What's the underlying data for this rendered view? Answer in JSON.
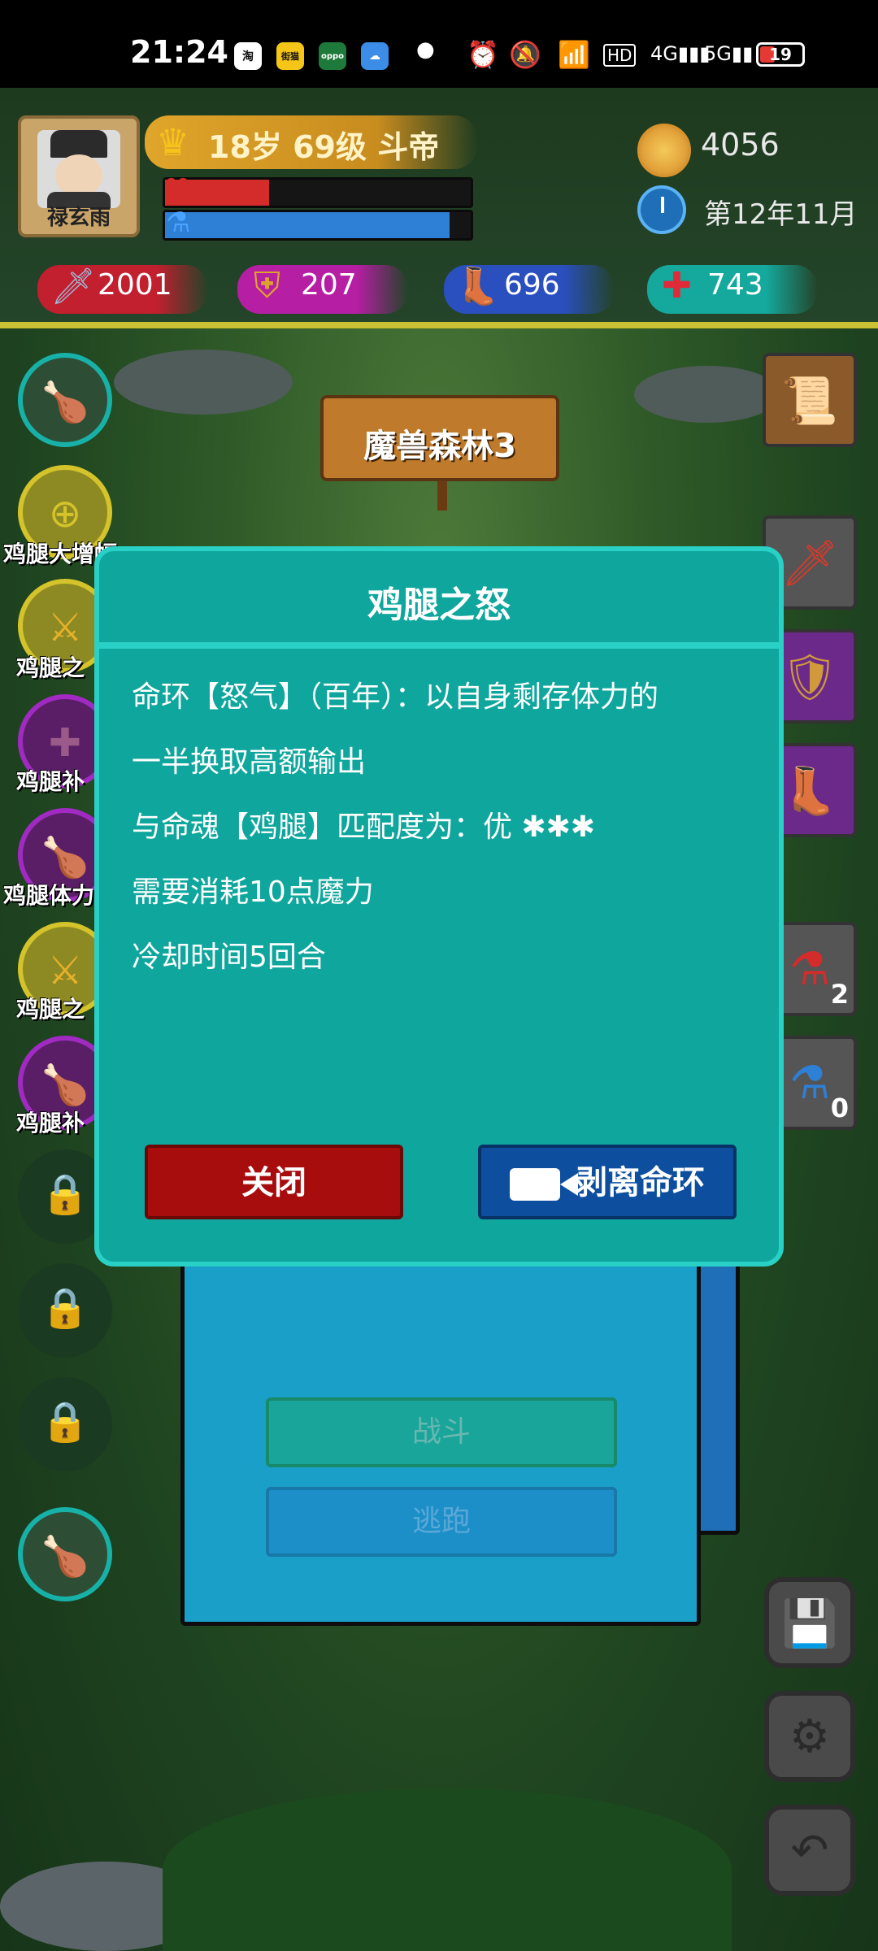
{
  "status_bar": {
    "time": "21:24",
    "battery": "19",
    "apps": [
      "淘",
      "街猫",
      "oppo",
      "☁"
    ]
  },
  "player": {
    "name": "禄玄雨",
    "title": "18岁 69级 斗帝",
    "hp_fraction": 0.34,
    "mp_fraction": 0.93,
    "gold": "4056",
    "date": "第12年11月",
    "stats": {
      "attack": "2001",
      "defense": "207",
      "speed": "696",
      "health": "743"
    }
  },
  "location": {
    "sign": "魔兽森林3"
  },
  "skills": [
    {
      "label": "鸡腿大增幅",
      "style": "yellow",
      "icon": "plus-icon"
    },
    {
      "label": "鸡腿之",
      "style": "yellow",
      "icon": "slash-icon"
    },
    {
      "label": "鸡腿补",
      "style": "purple",
      "icon": "plus-icon"
    },
    {
      "label": "鸡腿体力",
      "style": "purple",
      "icon": "drumstick-icon"
    },
    {
      "label": "鸡腿之",
      "style": "yellow",
      "icon": "slash-icon"
    },
    {
      "label": "鸡腿补",
      "style": "purple",
      "icon": "drumstick-icon"
    }
  ],
  "inventory": {
    "red_potion_count": "2",
    "blue_potion_count": "0"
  },
  "battle_panel": {
    "fight_label": "战斗",
    "flee_label": "逃跑"
  },
  "dialog": {
    "title": "鸡腿之怒",
    "lines": [
      "命环【怒气】（百年）：以自身剩存体力的",
      "一半换取高额输出",
      "与命魂【鸡腿】匹配度为：优 ✱✱✱",
      "需要消耗10点魔力",
      "冷却时间5回合"
    ],
    "close_label": "关闭",
    "peel_label": "剥离命环"
  },
  "colors": {
    "hp": "#d42b2b",
    "mp": "#2e7fd6",
    "dialog_bg": "#0fa69d",
    "close_btn": "#a80d0d",
    "peel_btn": "#0d4f9e"
  }
}
